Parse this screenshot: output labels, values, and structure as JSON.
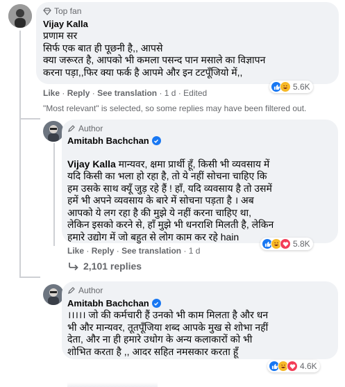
{
  "colors": {
    "link_blue": "#1877f2",
    "bubble_bg": "#f0f2f5",
    "meta_gray": "#65676b",
    "verified_blue": "#1877f2"
  },
  "comment1": {
    "badge": "Top fan",
    "name": "Vijay Kalla",
    "text": "प्रणाम सर\nसिर्फ एक बात ही पूछनी है,, आपसे\nक्या जरूरत है, आपको भी कमला पसन्द पान मसाले का विज्ञापन\nकरना पड़ा,,फिर क्या फर्क है आपमे और इन टटपूँजियो में,,",
    "actions": {
      "like": "Like",
      "reply": "Reply",
      "translate": "See translation",
      "time": "1 d",
      "edited": "Edited"
    },
    "reactions": {
      "icons": [
        "like-icon",
        "haha-icon"
      ],
      "count": "5.6K"
    }
  },
  "filter_notice": "\"Most relevant\" is selected, so some replies may have been filtered out.",
  "reply1": {
    "badge": "Author",
    "name": "Amitabh Bachchan",
    "mention": "Vijay Kalla",
    "text": " मान्यवर, क्षमा प्रार्थी हूँ, किसी भी व्यवसाय में\nयदि किसी का भला हो रहा है, तो ये नहीं सोचना चाहिए कि\nहम उसके साथ क्यूँ जुड़ रहे हैं ! हाँ, यदि व्यवसाय है तो उसमें\nहमें भी अपने व्यवसाय के बारे में सोचना पड़ता है । अब\nआपको ये लग रहा है की मुझे ये नहीं करना चाहिए था,\nलेकिन इसको करने से, हाँ मुझे भी धनराशि मिलती है, लेकिन\nहमारे उद्योग में जो बहुत से लोग काम कर रहे hain",
    "actions": {
      "like": "Like",
      "reply": "Reply",
      "translate": "See translation",
      "time": "1 d"
    },
    "reactions": {
      "icons": [
        "like-icon",
        "haha-icon",
        "love-icon"
      ],
      "count": "5.8K"
    },
    "replies_link": "2,101 replies"
  },
  "reply2": {
    "badge": "Author",
    "name": "Amitabh Bachchan",
    "text": "।।।।। जो की कर्मचारी हैं उनको भी काम मिलता है और धन\nभी और मान्यवर, तूतपूँजिया शब्द आपके मुख से शोभा नहीं\nदेता, और ना ही हमारे उधोग के अन्य कलाकारों को भी\nशोभित करता है ,, आदर सहित नमसकार करता हूँ",
    "reactions": {
      "icons": [
        "like-icon",
        "haha-icon",
        "love-icon"
      ],
      "count": "4.6K"
    }
  }
}
